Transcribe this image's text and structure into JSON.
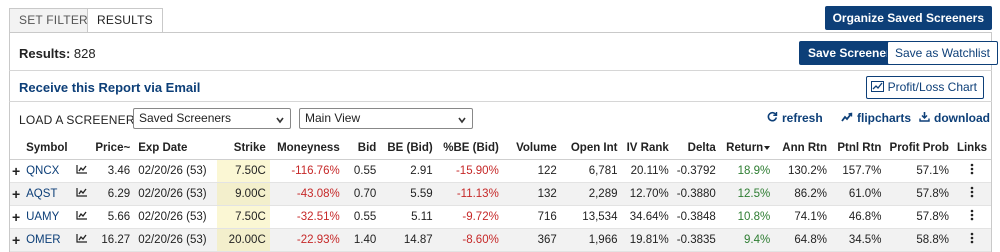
{
  "tabs": [
    {
      "label": "SET FILTERS",
      "active": false
    },
    {
      "label": "RESULTS",
      "active": true
    }
  ],
  "organize_button": "Organize Saved Screeners",
  "results": {
    "label": "Results:",
    "count": "828"
  },
  "save_screener_button": "Save Screener",
  "save_watchlist_button": "Save as Watchlist",
  "email_link": "Receive this Report via Email",
  "pl_chart_button": "Profit/Loss Chart",
  "load_screener": {
    "label": "LOAD A SCREENER:",
    "screener_select": "Saved Screeners",
    "view_select": "Main View"
  },
  "tools": {
    "refresh": "refresh",
    "flipcharts": "flipcharts",
    "download": "download"
  },
  "table": {
    "headers": {
      "symbol": "Symbol",
      "price": "Price~",
      "exp_date": "Exp Date",
      "strike": "Strike",
      "moneyness": "Moneyness",
      "bid": "Bid",
      "be_bid": "BE (Bid)",
      "pct_be_bid": "%BE (Bid)",
      "volume": "Volume",
      "open_int": "Open Int",
      "iv_rank": "IV Rank",
      "delta": "Delta",
      "return": "Return",
      "ann_rtn": "Ann Rtn",
      "ptnl_rtn": "Ptnl Rtn",
      "profit_prob": "Profit Prob",
      "links": "Links"
    },
    "rows": [
      {
        "symbol": "QNCX",
        "price": "3.46",
        "exp_date": "02/20/26 (53)",
        "strike": "7.50C",
        "moneyness": "-116.76%",
        "bid": "0.55",
        "be_bid": "2.91",
        "pct_be_bid": "-15.90%",
        "volume": "122",
        "open_int": "6,781",
        "iv_rank": "20.11%",
        "delta": "-0.3792",
        "return": "18.9%",
        "ann_rtn": "130.2%",
        "ptnl_rtn": "157.7%",
        "profit_prob": "57.1%"
      },
      {
        "symbol": "AQST",
        "price": "6.29",
        "exp_date": "02/20/26 (53)",
        "strike": "9.00C",
        "moneyness": "-43.08%",
        "bid": "0.70",
        "be_bid": "5.59",
        "pct_be_bid": "-11.13%",
        "volume": "132",
        "open_int": "2,289",
        "iv_rank": "12.70%",
        "delta": "-0.3880",
        "return": "12.5%",
        "ann_rtn": "86.2%",
        "ptnl_rtn": "61.0%",
        "profit_prob": "57.8%"
      },
      {
        "symbol": "UAMY",
        "price": "5.66",
        "exp_date": "02/20/26 (53)",
        "strike": "7.50C",
        "moneyness": "-32.51%",
        "bid": "0.55",
        "be_bid": "5.11",
        "pct_be_bid": "-9.72%",
        "volume": "716",
        "open_int": "13,534",
        "iv_rank": "34.64%",
        "delta": "-0.3848",
        "return": "10.8%",
        "ann_rtn": "74.1%",
        "ptnl_rtn": "46.8%",
        "profit_prob": "57.8%"
      },
      {
        "symbol": "OMER",
        "price": "16.27",
        "exp_date": "02/20/26 (53)",
        "strike": "20.00C",
        "moneyness": "-22.93%",
        "bid": "1.40",
        "be_bid": "14.87",
        "pct_be_bid": "-8.60%",
        "volume": "367",
        "open_int": "1,966",
        "iv_rank": "19.81%",
        "delta": "-0.3835",
        "return": "9.4%",
        "ann_rtn": "64.8%",
        "ptnl_rtn": "34.5%",
        "profit_prob": "58.8%"
      }
    ]
  },
  "colors": {
    "primary": "#0d3f78",
    "negative": "#c62828",
    "positive": "#2e7d32",
    "strike_highlight": "#fbf7d4"
  },
  "icons": {
    "expand": "plus-icon",
    "chart": "chart-line-icon",
    "links": "more-vertical-icon"
  }
}
